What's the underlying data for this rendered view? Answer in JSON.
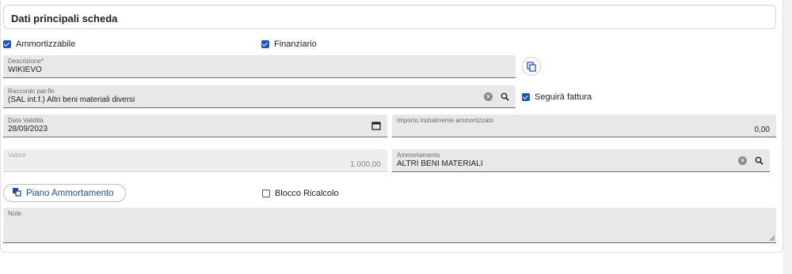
{
  "header": {
    "title": "Dati principali scheda"
  },
  "checkboxes": {
    "ammortizzabile": {
      "label": "Ammortizzabile",
      "checked": true
    },
    "finanziario": {
      "label": "Finanziario",
      "checked": true
    },
    "seguira_fattura": {
      "label": "Seguirà fattura",
      "checked": true
    },
    "blocco_ricalcolo": {
      "label": "Blocco Ricalcolo",
      "checked": false
    }
  },
  "fields": {
    "descrizione": {
      "label": "Descrizione",
      "required_mark": "*",
      "value": "WIKIEVO"
    },
    "raccordo": {
      "label": "Raccordo pat-fin",
      "value": "(SAL int.f.) Altri beni materiali diversi"
    },
    "data_validita": {
      "label": "Data Validità",
      "value": "28/09/2023"
    },
    "importo": {
      "label": "Importo Inizialmente ammortizzato",
      "value": "0,00"
    },
    "valore": {
      "label": "Valore",
      "value": "1.000,00"
    },
    "ammortamento": {
      "label": "Ammortamento",
      "value": "ALTRI BENI MATERIALI"
    },
    "note": {
      "label": "Note",
      "value": ""
    }
  },
  "buttons": {
    "piano_ammortamento": "Piano Ammortamento"
  },
  "colors": {
    "accent": "#1a56c7",
    "field_bg": "#e8e8e8",
    "link": "#1f4e9e"
  },
  "icons": [
    "copy-icon",
    "clear-icon",
    "search-icon",
    "calendar-icon",
    "chart-icon",
    "resize-icon"
  ]
}
